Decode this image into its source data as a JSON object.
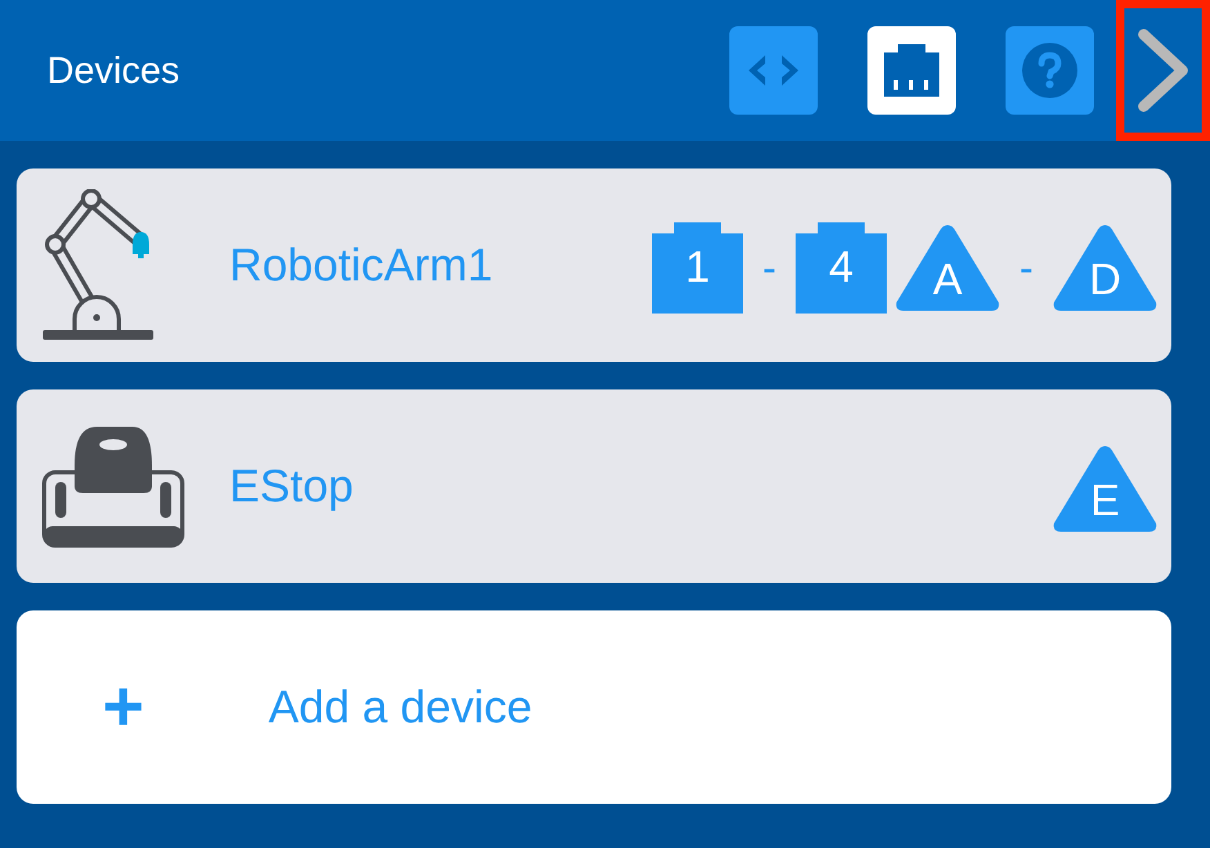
{
  "header": {
    "title": "Devices",
    "tools": [
      {
        "kind": "code",
        "selected": false
      },
      {
        "kind": "port",
        "selected": true
      },
      {
        "kind": "help",
        "selected": false
      }
    ],
    "next": {
      "highlighted": true
    }
  },
  "devices": [
    {
      "name": "RoboticArm1",
      "kind": "arm",
      "ports": [
        {
          "kind": "smart",
          "label": "1"
        },
        {
          "kind": "sep",
          "label": "-"
        },
        {
          "kind": "smart",
          "label": "4"
        },
        {
          "kind": "triangle",
          "label": "A"
        },
        {
          "kind": "sep",
          "label": "-"
        },
        {
          "kind": "triangle",
          "label": "D"
        }
      ]
    },
    {
      "name": "EStop",
      "kind": "estop",
      "ports": [
        {
          "kind": "triangle",
          "label": "E"
        }
      ]
    }
  ],
  "add": {
    "icon": "+",
    "label": "Add a device"
  }
}
